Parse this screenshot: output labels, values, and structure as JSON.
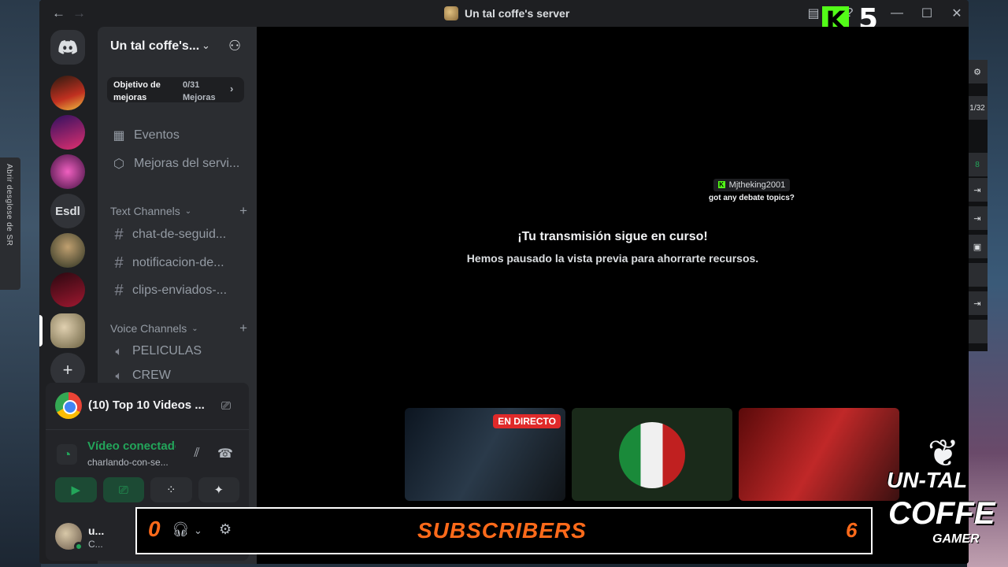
{
  "window": {
    "title": "Un tal coffe's server",
    "kick_viewers": "5"
  },
  "side_tab": {
    "label": "Abrir desglose de SR"
  },
  "right_strip": {
    "item_1": "1/32",
    "item_2": "8"
  },
  "server_rail": {
    "text_server": "Esdl"
  },
  "sidebar": {
    "server_name": "Un tal coffe's...",
    "boost": {
      "goal_label": "Objetivo de mejoras",
      "progress": "0/31",
      "progress_label": "Mejoras"
    },
    "nav": [
      {
        "label": "Eventos"
      },
      {
        "label": "Mejoras del servi..."
      }
    ],
    "text_category": "Text Channels",
    "text_channels": [
      {
        "name": "chat-de-seguid..."
      },
      {
        "name": "notificacion-de..."
      },
      {
        "name": "clips-enviados-..."
      }
    ],
    "voice_category": "Voice Channels",
    "voice_channels": [
      {
        "name": "PELICULAS"
      },
      {
        "name": "CREW"
      }
    ]
  },
  "panel": {
    "activity_title": "(10) Top 10 Videos ...",
    "voice_status": "Vídeo conectado",
    "voice_channel": "charlando-con-se...",
    "user_name": "u...",
    "user_status": "C..."
  },
  "main": {
    "stream_heading": "¡Tu transmisión sigue en curso!",
    "stream_sub": "Hemos pausado la vista previa para ahorrarte recursos.",
    "chat_user": "Mjtheking2001",
    "chat_message": "got any debate topics?",
    "live_badge": "EN DIRECTO"
  },
  "overlay": {
    "left_count": "0",
    "label": "SUBSCRIBERS",
    "right_count": "6"
  },
  "logo": {
    "line1": "UN-TAL",
    "line2": "COFFE",
    "line3": "GAMER"
  },
  "colors": {
    "accent_green": "#23a55a",
    "kick_green": "#53fc18",
    "overlay_orange": "#ff6a1a",
    "live_red": "#e02a2a"
  }
}
